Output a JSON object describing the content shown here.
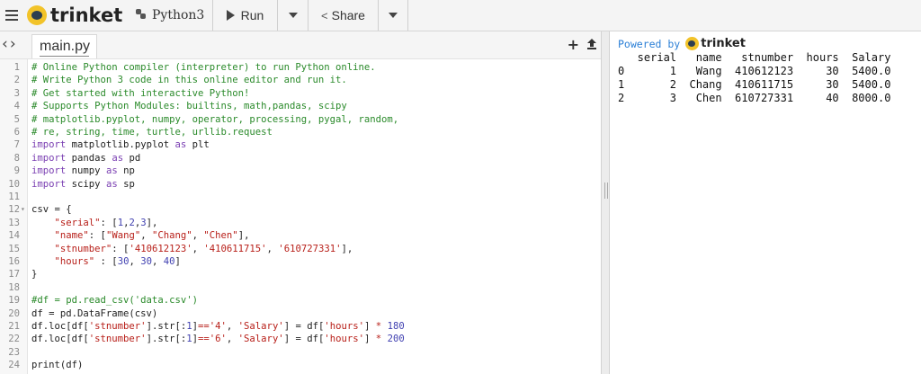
{
  "toolbar": {
    "app_name": "trinket",
    "language": "Python3",
    "run_label": "Run",
    "share_label": "Share"
  },
  "editor": {
    "file_tab": "main.py",
    "lines": [
      {
        "n": "1",
        "t": "# Online Python compiler (interpreter) to run Python online."
      },
      {
        "n": "2",
        "t": "# Write Python 3 code in this online editor and run it."
      },
      {
        "n": "3",
        "t": "# Get started with interactive Python!"
      },
      {
        "n": "4",
        "t": "# Supports Python Modules: builtins, math,pandas, scipy"
      },
      {
        "n": "5",
        "t": "# matplotlib.pyplot, numpy, operator, processing, pygal, random,"
      },
      {
        "n": "6",
        "t": "# re, string, time, turtle, urllib.request"
      },
      {
        "n": "7",
        "t": "import matplotlib.pyplot as plt"
      },
      {
        "n": "8",
        "t": "import pandas as pd"
      },
      {
        "n": "9",
        "t": "import numpy as np"
      },
      {
        "n": "10",
        "t": "import scipy as sp"
      },
      {
        "n": "11",
        "t": ""
      },
      {
        "n": "12",
        "t": "csv = {"
      },
      {
        "n": "13",
        "t": "    \"serial\": [1,2,3],"
      },
      {
        "n": "14",
        "t": "    \"name\": [\"Wang\", \"Chang\", \"Chen\"],"
      },
      {
        "n": "15",
        "t": "    \"stnumber\": ['410612123', '410611715', '610727331'],"
      },
      {
        "n": "16",
        "t": "    \"hours\" : [30, 30, 40]"
      },
      {
        "n": "17",
        "t": "}"
      },
      {
        "n": "18",
        "t": ""
      },
      {
        "n": "19",
        "t": "#df = pd.read_csv('data.csv')"
      },
      {
        "n": "20",
        "t": "df = pd.DataFrame(csv)"
      },
      {
        "n": "21",
        "t": "df.loc[df['stnumber'].str[:1]=='4', 'Salary'] = df['hours'] * 180"
      },
      {
        "n": "22",
        "t": "df.loc[df['stnumber'].str[:1]=='6', 'Salary'] = df['hours'] * 200"
      },
      {
        "n": "23",
        "t": ""
      },
      {
        "n": "24",
        "t": "print(df)"
      }
    ]
  },
  "output": {
    "powered_by": "Powered by",
    "brand": "trinket",
    "lines": [
      "   serial   name   stnumber  hours  Salary",
      "0       1   Wang  410612123     30  5400.0",
      "1       2  Chang  410611715     30  5400.0",
      "2       3   Chen  610727331     40  8000.0"
    ]
  }
}
